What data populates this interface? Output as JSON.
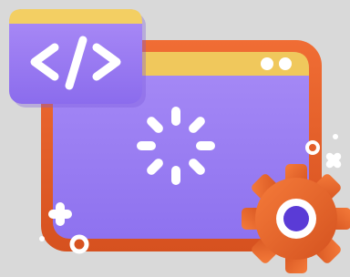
{
  "illustration": {
    "code_card": {
      "glyph": "</>"
    },
    "colors": {
      "background": "#d9d9d9",
      "window_frame": "#e2612a",
      "window_body": "#9d82f4",
      "title_bar": "#f0c85c",
      "code_card": "#a07ff5",
      "code_card_top": "#f3cf63",
      "spinner": "#ffffff",
      "gear": "#ea6a2f",
      "gear_center": "#5a3bd6"
    },
    "icons": [
      "code-brackets-icon",
      "loading-spinner-icon",
      "gear-icon",
      "plus-icon",
      "ring-icon"
    ]
  }
}
